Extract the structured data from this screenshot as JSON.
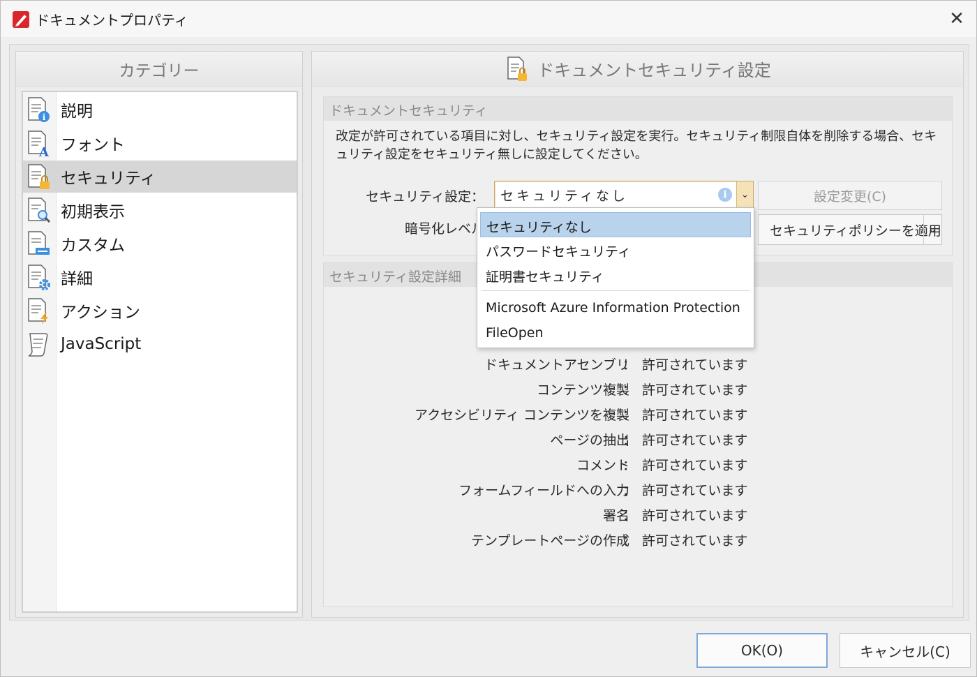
{
  "window": {
    "title": "ドキュメントプロパティ",
    "close_label": "✕"
  },
  "category_panel": {
    "header": "カテゴリー",
    "items": [
      {
        "label": "説明",
        "icon": "doc-info-icon"
      },
      {
        "label": "フォント",
        "icon": "doc-font-icon"
      },
      {
        "label": "セキュリティ",
        "icon": "doc-lock-icon",
        "selected": true
      },
      {
        "label": "初期表示",
        "icon": "doc-magnifier-icon"
      },
      {
        "label": "カスタム",
        "icon": "doc-custom-icon"
      },
      {
        "label": "詳細",
        "icon": "doc-gear-icon"
      },
      {
        "label": "アクション",
        "icon": "doc-lightning-icon"
      },
      {
        "label": "JavaScript",
        "icon": "scroll-icon"
      }
    ]
  },
  "main_panel": {
    "header": "ドキュメントセキュリティ設定",
    "security_group": {
      "title": "ドキュメントセキュリティ",
      "description": "改定が許可されている項目に対し、セキュリティ設定を実行。セキュリティ制限自体を削除する場合、セキュリティ設定をセキュリティ無しに設定してください。",
      "security_setting_label": "セキュリティ設定：",
      "security_setting_value": "セキュリティなし",
      "change_settings_button": "設定変更(C)",
      "encryption_level_label": "暗号化レベル",
      "apply_policy_button": "セキュリティポリシーを適用"
    },
    "details_group": {
      "title": "セキュリティ設定詳細",
      "permissions": [
        {
          "label": "ドキュメントアセンブリ",
          "value": "許可されています"
        },
        {
          "label": "コンテンツ複製",
          "value": "許可されています"
        },
        {
          "label": "アクセシビリティ コンテンツを複製",
          "value": "許可されています"
        },
        {
          "label": "ページの抽出",
          "value": "許可されています"
        },
        {
          "label": "コメント",
          "value": "許可されています"
        },
        {
          "label": "フォームフィールドへの入力",
          "value": "許可されています"
        },
        {
          "label": "署名",
          "value": "許可されています"
        },
        {
          "label": "テンプレートページの作成",
          "value": "許可されています"
        }
      ],
      "colon": "："
    }
  },
  "dropdown": {
    "options": [
      "セキュリティなし",
      "パスワードセキュリティ",
      "証明書セキュリティ",
      "Microsoft Azure Information Protection",
      "FileOpen"
    ],
    "selected": "セキュリティなし"
  },
  "footer": {
    "ok_button": "OK(O)",
    "cancel_button": "キャンセル(C)"
  },
  "colors": {
    "selection": "#b9d3ec",
    "lock_badge": "#f5b731",
    "info_badge": "#3d8fe0",
    "app_icon": "#d9262c"
  }
}
